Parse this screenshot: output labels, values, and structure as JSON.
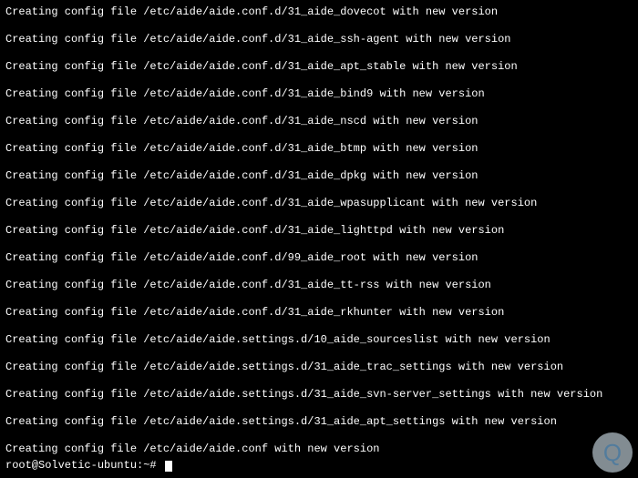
{
  "lines": [
    "Creating config file /etc/aide/aide.conf.d/31_aide_dovecot with new version",
    "Creating config file /etc/aide/aide.conf.d/31_aide_ssh-agent with new version",
    "Creating config file /etc/aide/aide.conf.d/31_aide_apt_stable with new version",
    "Creating config file /etc/aide/aide.conf.d/31_aide_bind9 with new version",
    "Creating config file /etc/aide/aide.conf.d/31_aide_nscd with new version",
    "Creating config file /etc/aide/aide.conf.d/31_aide_btmp with new version",
    "Creating config file /etc/aide/aide.conf.d/31_aide_dpkg with new version",
    "Creating config file /etc/aide/aide.conf.d/31_aide_wpasupplicant with new version",
    "Creating config file /etc/aide/aide.conf.d/31_aide_lighttpd with new version",
    "Creating config file /etc/aide/aide.conf.d/99_aide_root with new version",
    "Creating config file /etc/aide/aide.conf.d/31_aide_tt-rss with new version",
    "Creating config file /etc/aide/aide.conf.d/31_aide_rkhunter with new version",
    "Creating config file /etc/aide/aide.settings.d/10_aide_sourceslist with new version",
    "Creating config file /etc/aide/aide.settings.d/31_aide_trac_settings with new version",
    "Creating config file /etc/aide/aide.settings.d/31_aide_svn-server_settings with new version",
    "Creating config file /etc/aide/aide.settings.d/31_aide_apt_settings with new version"
  ],
  "final_line": "Creating config file /etc/aide/aide.conf with new version",
  "prompt": "root@Solvetic-ubuntu:~# ",
  "watermark": "Q"
}
